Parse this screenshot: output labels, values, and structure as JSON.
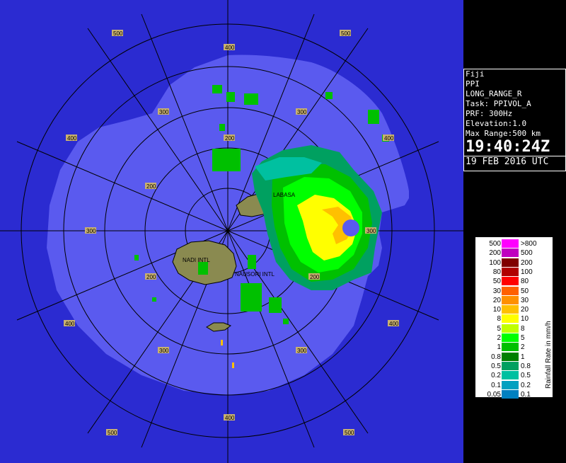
{
  "colors": {
    "background": "#2b2bd1",
    "coverage": "#5a5aef",
    "land": "#8a8a50",
    "ring": "#000000"
  },
  "range_labels": [
    "500",
    "400",
    "300",
    "200",
    "300",
    "400",
    "500",
    "300",
    "200",
    "400",
    "500"
  ],
  "towns": {
    "labasa": "LABASA",
    "nadi": "NADI INTL",
    "nausori": "NAUSORI INTL"
  },
  "info": {
    "site": "Fiji",
    "product": "PPI",
    "mode": "LONG_RANGE_R",
    "task": "Task: PPIVOL_A",
    "prf": "PRF: 300Hz",
    "elevation": "Elevation:1.0",
    "max_range": "Max Range:500 km",
    "time": "19:40:24Z",
    "date": "19 FEB 2016 UTC"
  },
  "legend": {
    "title": "Rainfall Rate in mm/h",
    "rows": [
      {
        "lo": "500",
        "hi": ">800",
        "color": "#ff00ff"
      },
      {
        "lo": "200",
        "hi": "500",
        "color": "#c000c0"
      },
      {
        "lo": "100",
        "hi": "200",
        "color": "#800000"
      },
      {
        "lo": "80",
        "hi": "100",
        "color": "#b00000"
      },
      {
        "lo": "50",
        "hi": "80",
        "color": "#ff0000"
      },
      {
        "lo": "30",
        "hi": "50",
        "color": "#ff6000"
      },
      {
        "lo": "20",
        "hi": "30",
        "color": "#ff9000"
      },
      {
        "lo": "10",
        "hi": "20",
        "color": "#ffc000"
      },
      {
        "lo": "8",
        "hi": "10",
        "color": "#ffff00"
      },
      {
        "lo": "5",
        "hi": "8",
        "color": "#c0ff00"
      },
      {
        "lo": "2",
        "hi": "5",
        "color": "#00ff00"
      },
      {
        "lo": "1",
        "hi": "2",
        "color": "#00c000"
      },
      {
        "lo": "0.8",
        "hi": "1",
        "color": "#008000"
      },
      {
        "lo": "0.5",
        "hi": "0.8",
        "color": "#00a060"
      },
      {
        "lo": "0.2",
        "hi": "0.5",
        "color": "#00c0a0"
      },
      {
        "lo": "0.1",
        "hi": "0.2",
        "color": "#00a0c0"
      },
      {
        "lo": "0.05",
        "hi": "0.1",
        "color": "#0080c0"
      }
    ]
  }
}
